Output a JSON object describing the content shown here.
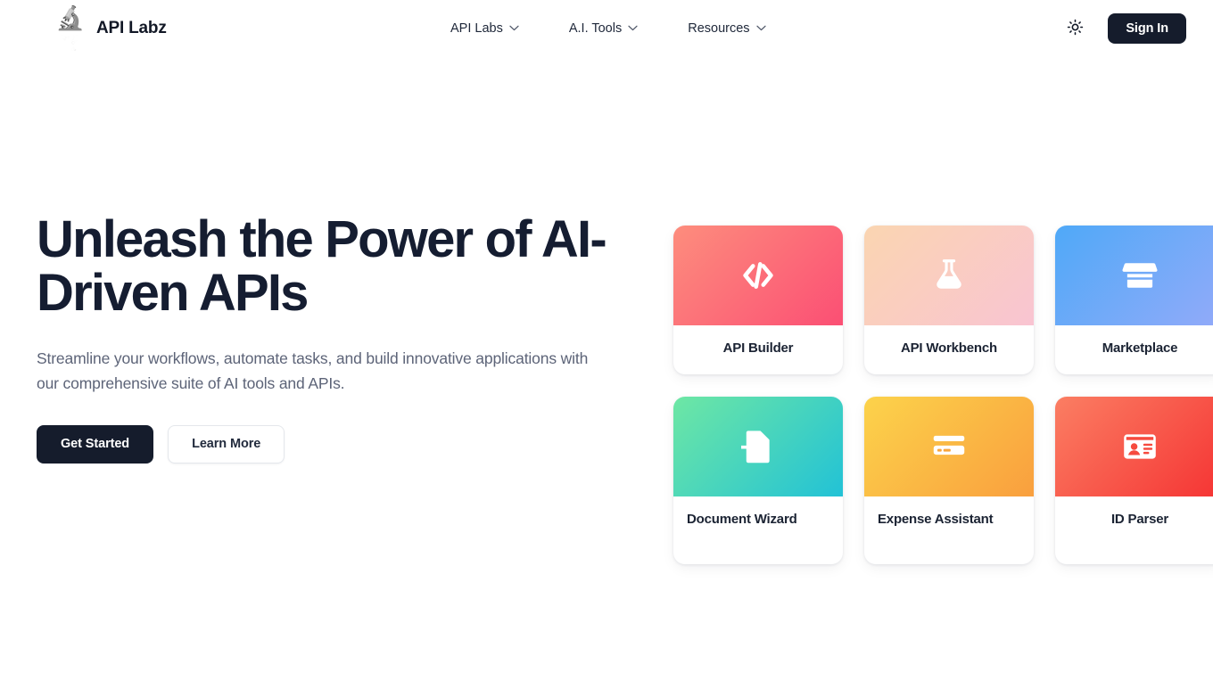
{
  "header": {
    "brand": {
      "logo_icon": "microscope-icon",
      "logo_glyph": "🔬",
      "name": "API Labz"
    },
    "nav": [
      {
        "label": "API Labs",
        "icon": "chevron-down-icon"
      },
      {
        "label": "A.I. Tools",
        "icon": "chevron-down-icon"
      },
      {
        "label": "Resources",
        "icon": "chevron-down-icon"
      }
    ],
    "theme_toggle_icon": "sun-icon",
    "signin_label": "Sign In"
  },
  "hero": {
    "title": "Unleash the Power of AI-Driven APIs",
    "subtitle": "Streamline your workflows, automate tasks, and build innovative applications with our comprehensive suite of AI tools and APIs.",
    "primary_cta": "Get Started",
    "secondary_cta": "Learn More"
  },
  "cards": [
    {
      "label": "API Builder",
      "icon": "code-brackets-icon",
      "gradient_from": "#fd8d7d",
      "gradient_to": "#fb4f74",
      "multiline": false
    },
    {
      "label": "API Workbench",
      "icon": "flask-icon",
      "gradient_from": "#fad5b1",
      "gradient_to": "#f9c4d2",
      "multiline": false
    },
    {
      "label": "Marketplace",
      "icon": "storefront-icon",
      "gradient_from": "#4fa9f8",
      "gradient_to": "#93aaf9",
      "multiline": false
    },
    {
      "label": "Document Wizard",
      "icon": "document-import-icon",
      "gradient_from": "#6ee7a4",
      "gradient_to": "#22c2d6",
      "multiline": true
    },
    {
      "label": "Expense Assistant",
      "icon": "credit-card-icon",
      "gradient_from": "#fcd34b",
      "gradient_to": "#f99f3e",
      "multiline": true
    },
    {
      "label": "ID Parser",
      "icon": "id-card-icon",
      "gradient_from": "#fb7e63",
      "gradient_to": "#f53333",
      "multiline": false
    }
  ],
  "colors": {
    "ink": "#151d31",
    "muted": "#5d6478",
    "dark_button": "#151c2c",
    "page_bg": "#ffffff"
  }
}
